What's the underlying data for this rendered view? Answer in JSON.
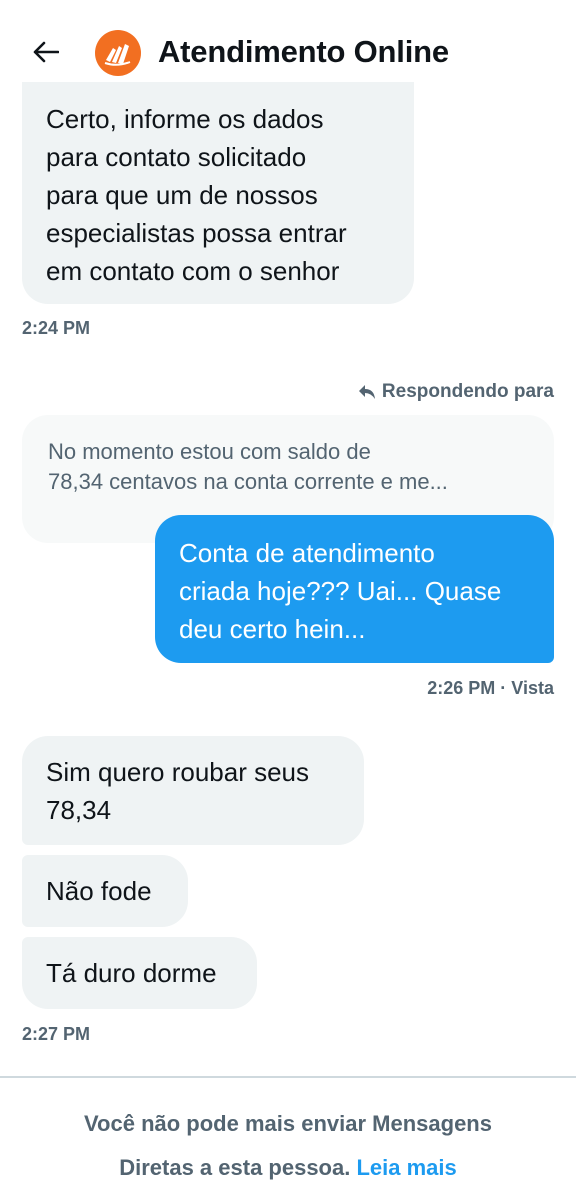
{
  "header": {
    "title": "Atendimento Online",
    "back_icon": "back-arrow-icon",
    "avatar_color": "#f26f21"
  },
  "messages": [
    {
      "direction": "incoming",
      "lines": [
        "Certo, informe os dados",
        "para contato solicitado",
        "para que um de nossos",
        "especialistas possa entrar",
        "em contato com o senhor"
      ],
      "time": "2:24 PM"
    },
    {
      "direction": "outgoing",
      "reply_label": "Respondendo para",
      "quoted_lines": [
        "No momento estou com saldo de",
        "78,34 centavos na conta corrente e me..."
      ],
      "lines": [
        "Conta de atendimento",
        "criada hoje??? Uai... Quase",
        "deu certo hein..."
      ],
      "time": "2:26 PM · Vista"
    },
    {
      "direction": "incoming",
      "lines": [
        "Sim quero roubar seus",
        "78,34"
      ]
    },
    {
      "direction": "incoming",
      "lines": [
        "Não fode"
      ]
    },
    {
      "direction": "incoming",
      "lines": [
        "Tá duro dorme"
      ],
      "time": "2:27 PM"
    }
  ],
  "footer": {
    "line1": "Você não pode mais enviar Mensagens",
    "line2": "Diretas a esta pessoa.",
    "link": "Leia mais"
  },
  "colors": {
    "accent": "#1d9bf0",
    "incoming_bubble": "#eff3f4",
    "secondary_text": "#536471"
  }
}
